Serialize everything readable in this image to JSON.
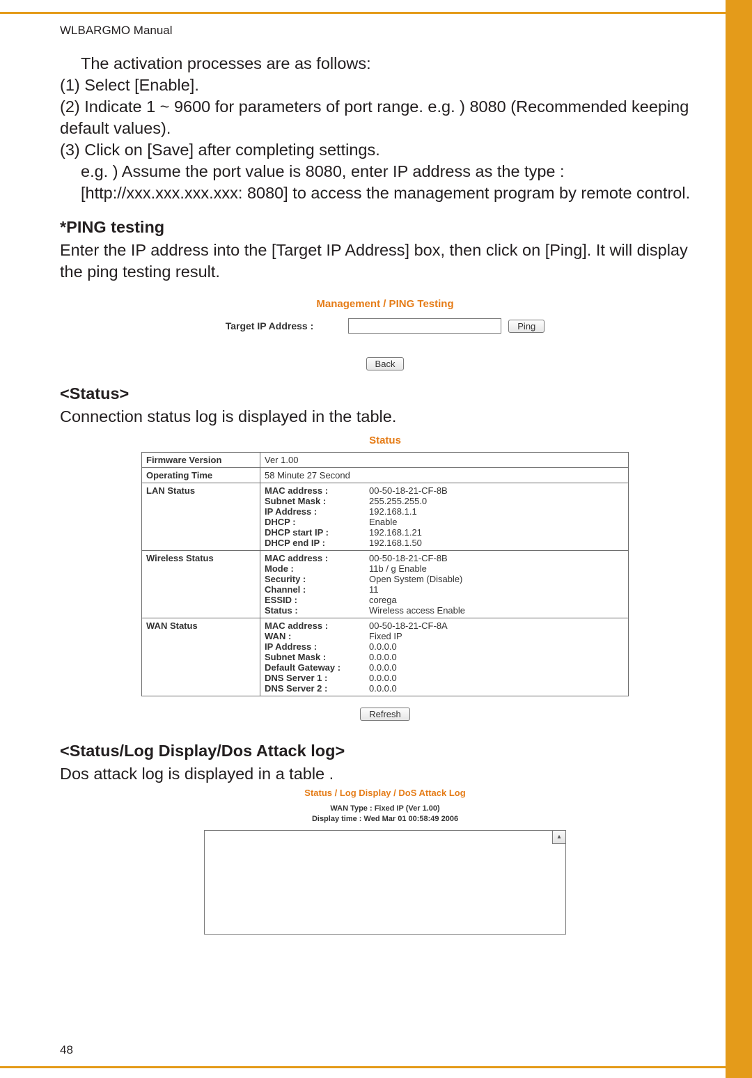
{
  "header": {
    "title": "WLBARGMO Manual"
  },
  "page_number": "48",
  "intro": {
    "line1": "The activation processes are as follows:",
    "step1": "(1) Select [Enable].",
    "step2": "(2) Indicate 1 ~ 9600 for parameters of port range. e.g. ) 8080 (Recommended keeping default values).",
    "step3a": "(3) Click on [Save] after completing settings.",
    "step3b": "e.g. ) Assume the port value is 8080, enter IP address as the type : [http://xxx.xxx.xxx.xxx: 8080] to access the management program by remote control."
  },
  "ping": {
    "heading": "*PING testing",
    "desc": "Enter the IP address into the [Target IP Address] box, then click on [Ping]. It will display the ping testing result.",
    "panel_title": "Management / PING Testing",
    "target_label": "Target IP Address :",
    "ping_btn": "Ping",
    "back_btn": "Back"
  },
  "status": {
    "heading": "<Status>",
    "desc": "Connection status log is displayed in the table.",
    "panel_title": "Status",
    "refresh_btn": "Refresh",
    "rows": {
      "firmware_label": "Firmware Version",
      "firmware_value": "Ver 1.00",
      "optime_label": "Operating Time",
      "optime_value": "58 Minute 27 Second",
      "lan_label": "LAN Status",
      "wireless_label": "Wireless Status",
      "wan_label": "WAN Status"
    },
    "lan": [
      {
        "k": "MAC address :",
        "v": "00-50-18-21-CF-8B"
      },
      {
        "k": "Subnet Mask :",
        "v": "255.255.255.0"
      },
      {
        "k": "IP Address :",
        "v": "192.168.1.1"
      },
      {
        "k": "DHCP :",
        "v": "Enable"
      },
      {
        "k": "DHCP start IP :",
        "v": "192.168.1.21"
      },
      {
        "k": "DHCP end IP :",
        "v": "192.168.1.50"
      }
    ],
    "wireless": [
      {
        "k": "MAC address :",
        "v": "00-50-18-21-CF-8B"
      },
      {
        "k": "Mode :",
        "v": "11b / g Enable"
      },
      {
        "k": "Security :",
        "v": "Open System (Disable)"
      },
      {
        "k": "Channel :",
        "v": "11"
      },
      {
        "k": "ESSID :",
        "v": "corega"
      },
      {
        "k": "Status :",
        "v": "Wireless access Enable"
      }
    ],
    "wan": [
      {
        "k": "MAC address :",
        "v": "00-50-18-21-CF-8A"
      },
      {
        "k": "WAN :",
        "v": "Fixed IP"
      },
      {
        "k": "IP Address :",
        "v": "0.0.0.0"
      },
      {
        "k": "Subnet Mask :",
        "v": "0.0.0.0"
      },
      {
        "k": "Default Gateway :",
        "v": "0.0.0.0"
      },
      {
        "k": "DNS Server 1 :",
        "v": "0.0.0.0"
      },
      {
        "k": "DNS Server 2 :",
        "v": "0.0.0.0"
      }
    ]
  },
  "dos": {
    "heading": "<Status/Log Display/Dos Attack log>",
    "desc": "Dos attack log is displayed in a table .",
    "panel_title": "Status / Log Display / DoS Attack Log",
    "meta_line1": "WAN Type : Fixed IP (Ver 1.00)",
    "meta_line2": "Display time : Wed Mar 01 00:58:49 2006"
  }
}
